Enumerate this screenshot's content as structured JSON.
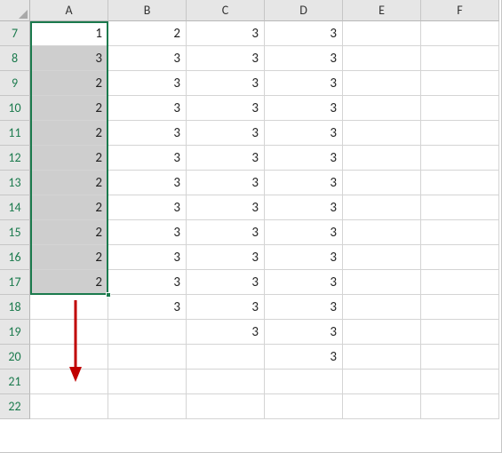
{
  "columns": [
    "A",
    "B",
    "C",
    "D",
    "E",
    "F"
  ],
  "rows": [
    7,
    8,
    9,
    10,
    11,
    12,
    13,
    14,
    15,
    16,
    17,
    18,
    19,
    20,
    21,
    22
  ],
  "cells": {
    "7": {
      "A": 1,
      "B": 2,
      "C": 3,
      "D": 3
    },
    "8": {
      "A": 3,
      "B": 3,
      "C": 3,
      "D": 3
    },
    "9": {
      "A": 2,
      "B": 3,
      "C": 3,
      "D": 3
    },
    "10": {
      "A": 2,
      "B": 3,
      "C": 3,
      "D": 3
    },
    "11": {
      "A": 2,
      "B": 3,
      "C": 3,
      "D": 3
    },
    "12": {
      "A": 2,
      "B": 3,
      "C": 3,
      "D": 3
    },
    "13": {
      "A": 2,
      "B": 3,
      "C": 3,
      "D": 3
    },
    "14": {
      "A": 2,
      "B": 3,
      "C": 3,
      "D": 3
    },
    "15": {
      "A": 2,
      "B": 3,
      "C": 3,
      "D": 3
    },
    "16": {
      "A": 2,
      "B": 3,
      "C": 3,
      "D": 3
    },
    "17": {
      "A": 2,
      "B": 3,
      "C": 3,
      "D": 3
    },
    "18": {
      "B": 3,
      "C": 3,
      "D": 3
    },
    "19": {
      "C": 3,
      "D": 3
    },
    "20": {
      "D": 3
    }
  },
  "selection": {
    "col": "A",
    "rowStart": 7,
    "rowEnd": 17
  },
  "annotation_arrow": {
    "color": "#c00000"
  }
}
